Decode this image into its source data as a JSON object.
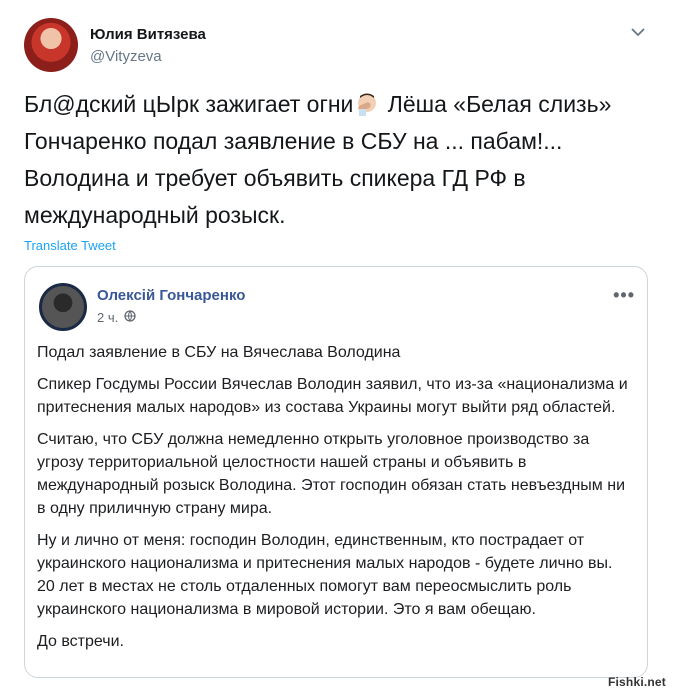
{
  "tweet": {
    "author_name": "Юлия Витязева",
    "author_handle": "@Vityzeva",
    "text_part1": "Бл@дский цЫрк зажигает огни",
    "text_part2": " Лёша «Белая слизь» Гончаренко подал заявление в СБУ на ... пабам!... Володина и требует объявить спикера ГД РФ в международный розыск.",
    "translate_label": "Translate Tweet",
    "icons": {
      "caret": "chevron-down-icon",
      "emoji": "facepalm-icon"
    }
  },
  "quote": {
    "author_name": "Олексій Гончаренко",
    "time": "2 ч.",
    "icons": {
      "privacy": "globe-icon",
      "more": "more-options-icon"
    },
    "more_label": "•••",
    "paragraphs": [
      "Подал заявление в СБУ на Вячеслава Володина",
      "Спикер Госдумы России Вячеслав Володин заявил, что из-за «национализма и притеснения малых народов» из состава Украины могут выйти ряд областей.",
      "Считаю, что СБУ должна немедленно открыть уголовное производство за угрозу территориальной целостности нашей страны и объявить в международный розыск Володина. Этот господин обязан стать невъездным ни в одну приличную страну мира.",
      "Ну и лично от меня: господин Володин, единственным, кто пострадает от украинского национализма и притеснения малых народов - будете лично вы. 20 лет в местах не столь отдаленных помогут вам переосмыслить роль украинского национализма в мировой истории. Это я вам обещаю.",
      "До встречи."
    ]
  },
  "watermark": "Fishki.net",
  "colors": {
    "twitter_blue": "#1da1f2",
    "facebook_name": "#385898",
    "text": "#14171a",
    "secondary": "#657786",
    "border": "#ccd6dd"
  }
}
